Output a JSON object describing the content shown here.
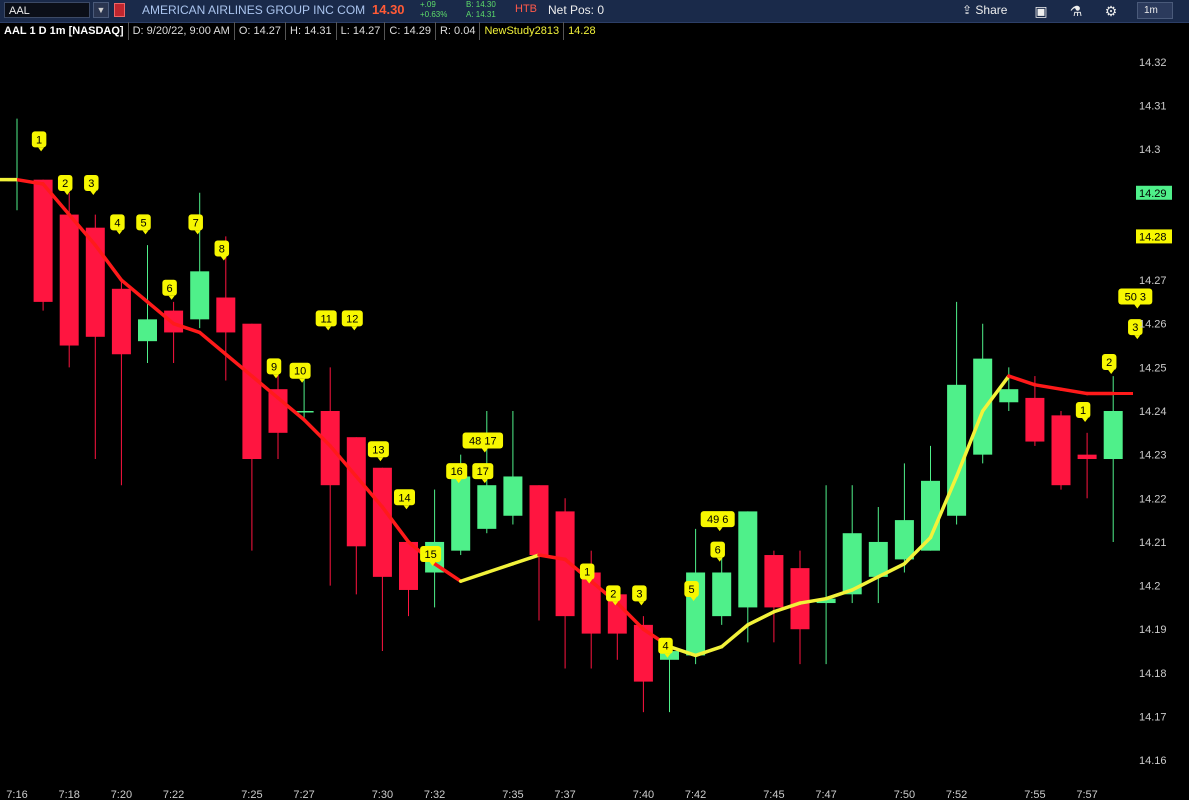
{
  "toolbar": {
    "symbol": "AAL",
    "company": "AMERICAN AIRLINES GROUP INC COM",
    "last": "14.30",
    "change_abs": "+.09",
    "change_pct": "+0.63%",
    "bid": "B: 14.30",
    "ask": "A: 14.31",
    "htb": "HTB",
    "net_pos": "Net Pos: 0",
    "share_label": "Share",
    "aggregation": "1m",
    "icons": [
      "dropdown-icon",
      "flag-icon",
      "share-icon",
      "details-icon",
      "flask-icon",
      "gear-icon"
    ]
  },
  "header": {
    "title": "AAL 1 D 1m [NASDAQ]",
    "date": "D: 9/20/22, 9:00 AM",
    "open": "O: 14.27",
    "high": "H: 14.31",
    "low": "L: 14.27",
    "close": "C: 14.29",
    "range": "R: 0.04",
    "study_name": "NewStudy2813",
    "study_value": "14.28"
  },
  "colors": {
    "up": "#4ff08a",
    "down": "#ff1540",
    "ma_up": "#f2f23a",
    "ma_down": "#ff1a1a",
    "marker": "#f7f700",
    "price_tag": "#4ff08a",
    "study_tag": "#f7f700"
  },
  "chart_data": {
    "type": "candlestick",
    "ylim": [
      14.155,
      14.325
    ],
    "y_ticks": [
      "14.32",
      "14.31",
      "14.3",
      "14.29",
      "14.28",
      "14.27",
      "14.26",
      "14.25",
      "14.24",
      "14.23",
      "14.22",
      "14.21",
      "14.2",
      "14.19",
      "14.18",
      "14.17",
      "14.16"
    ],
    "x_tick_labels": [
      {
        "i": 0,
        "label": "7:16"
      },
      {
        "i": 2,
        "label": "7:18"
      },
      {
        "i": 4,
        "label": "7:20"
      },
      {
        "i": 6,
        "label": "7:22"
      },
      {
        "i": 9,
        "label": "7:25"
      },
      {
        "i": 11,
        "label": "7:27"
      },
      {
        "i": 14,
        "label": "7:30"
      },
      {
        "i": 16,
        "label": "7:32"
      },
      {
        "i": 19,
        "label": "7:35"
      },
      {
        "i": 21,
        "label": "7:37"
      },
      {
        "i": 24,
        "label": "7:40"
      },
      {
        "i": 26,
        "label": "7:42"
      },
      {
        "i": 29,
        "label": "7:45"
      },
      {
        "i": 31,
        "label": "7:47"
      },
      {
        "i": 34,
        "label": "7:50"
      },
      {
        "i": 36,
        "label": "7:52"
      },
      {
        "i": 39,
        "label": "7:55"
      },
      {
        "i": 41,
        "label": "7:57"
      }
    ],
    "candles": [
      {
        "o": 14.293,
        "h": 14.307,
        "l": 14.286,
        "c": 14.293
      },
      {
        "o": 14.293,
        "h": 14.293,
        "l": 14.263,
        "c": 14.265
      },
      {
        "o": 14.285,
        "h": 14.29,
        "l": 14.25,
        "c": 14.255
      },
      {
        "o": 14.282,
        "h": 14.285,
        "l": 14.229,
        "c": 14.257
      },
      {
        "o": 14.268,
        "h": 14.27,
        "l": 14.223,
        "c": 14.253
      },
      {
        "o": 14.256,
        "h": 14.278,
        "l": 14.251,
        "c": 14.261
      },
      {
        "o": 14.263,
        "h": 14.265,
        "l": 14.251,
        "c": 14.258
      },
      {
        "o": 14.261,
        "h": 14.29,
        "l": 14.259,
        "c": 14.272
      },
      {
        "o": 14.266,
        "h": 14.28,
        "l": 14.247,
        "c": 14.258
      },
      {
        "o": 14.26,
        "h": 14.26,
        "l": 14.208,
        "c": 14.229
      },
      {
        "o": 14.245,
        "h": 14.25,
        "l": 14.229,
        "c": 14.235
      },
      {
        "o": 14.24,
        "h": 14.248,
        "l": 14.238,
        "c": 14.24
      },
      {
        "o": 14.24,
        "h": 14.25,
        "l": 14.2,
        "c": 14.223
      },
      {
        "o": 14.234,
        "h": 14.234,
        "l": 14.198,
        "c": 14.209
      },
      {
        "o": 14.227,
        "h": 14.227,
        "l": 14.185,
        "c": 14.202
      },
      {
        "o": 14.21,
        "h": 14.21,
        "l": 14.193,
        "c": 14.199
      },
      {
        "o": 14.203,
        "h": 14.222,
        "l": 14.195,
        "c": 14.21
      },
      {
        "o": 14.208,
        "h": 14.23,
        "l": 14.207,
        "c": 14.225
      },
      {
        "o": 14.213,
        "h": 14.24,
        "l": 14.212,
        "c": 14.223
      },
      {
        "o": 14.216,
        "h": 14.24,
        "l": 14.214,
        "c": 14.225
      },
      {
        "o": 14.223,
        "h": 14.223,
        "l": 14.192,
        "c": 14.207
      },
      {
        "o": 14.217,
        "h": 14.22,
        "l": 14.181,
        "c": 14.193
      },
      {
        "o": 14.203,
        "h": 14.208,
        "l": 14.181,
        "c": 14.189
      },
      {
        "o": 14.198,
        "h": 14.2,
        "l": 14.183,
        "c": 14.189
      },
      {
        "o": 14.191,
        "h": 14.193,
        "l": 14.171,
        "c": 14.178
      },
      {
        "o": 14.183,
        "h": 14.188,
        "l": 14.171,
        "c": 14.185
      },
      {
        "o": 14.184,
        "h": 14.213,
        "l": 14.182,
        "c": 14.203
      },
      {
        "o": 14.193,
        "h": 14.21,
        "l": 14.191,
        "c": 14.203
      },
      {
        "o": 14.195,
        "h": 14.217,
        "l": 14.187,
        "c": 14.217
      },
      {
        "o": 14.207,
        "h": 14.208,
        "l": 14.187,
        "c": 14.195
      },
      {
        "o": 14.204,
        "h": 14.208,
        "l": 14.182,
        "c": 14.19
      },
      {
        "o": 14.196,
        "h": 14.223,
        "l": 14.182,
        "c": 14.197
      },
      {
        "o": 14.198,
        "h": 14.223,
        "l": 14.196,
        "c": 14.212
      },
      {
        "o": 14.202,
        "h": 14.218,
        "l": 14.196,
        "c": 14.21
      },
      {
        "o": 14.206,
        "h": 14.228,
        "l": 14.203,
        "c": 14.215
      },
      {
        "o": 14.208,
        "h": 14.232,
        "l": 14.208,
        "c": 14.224
      },
      {
        "o": 14.216,
        "h": 14.265,
        "l": 14.214,
        "c": 14.246
      },
      {
        "o": 14.23,
        "h": 14.26,
        "l": 14.228,
        "c": 14.252
      },
      {
        "o": 14.242,
        "h": 14.25,
        "l": 14.24,
        "c": 14.245
      },
      {
        "o": 14.243,
        "h": 14.248,
        "l": 14.232,
        "c": 14.233
      },
      {
        "o": 14.239,
        "h": 14.24,
        "l": 14.222,
        "c": 14.223
      },
      {
        "o": 14.23,
        "h": 14.235,
        "l": 14.22,
        "c": 14.229
      },
      {
        "o": 14.229,
        "h": 14.248,
        "l": 14.21,
        "c": 14.24
      }
    ],
    "moving_average": [
      {
        "i": 0,
        "v": 14.293,
        "state": "up"
      },
      {
        "i": 1,
        "v": 14.292,
        "state": "down"
      },
      {
        "i": 2,
        "v": 14.285,
        "state": "down"
      },
      {
        "i": 3,
        "v": 14.278,
        "state": "down"
      },
      {
        "i": 4,
        "v": 14.27,
        "state": "down"
      },
      {
        "i": 5,
        "v": 14.265,
        "state": "down"
      },
      {
        "i": 6,
        "v": 14.26,
        "state": "down"
      },
      {
        "i": 7,
        "v": 14.258,
        "state": "down"
      },
      {
        "i": 8,
        "v": 14.253,
        "state": "down"
      },
      {
        "i": 9,
        "v": 14.248,
        "state": "down"
      },
      {
        "i": 10,
        "v": 14.243,
        "state": "down"
      },
      {
        "i": 11,
        "v": 14.238,
        "state": "down"
      },
      {
        "i": 12,
        "v": 14.232,
        "state": "down"
      },
      {
        "i": 13,
        "v": 14.225,
        "state": "down"
      },
      {
        "i": 14,
        "v": 14.218,
        "state": "down"
      },
      {
        "i": 15,
        "v": 14.21,
        "state": "down"
      },
      {
        "i": 16,
        "v": 14.205,
        "state": "down"
      },
      {
        "i": 17,
        "v": 14.201,
        "state": "down"
      },
      {
        "i": 18,
        "v": 14.203,
        "state": "up"
      },
      {
        "i": 19,
        "v": 14.205,
        "state": "up"
      },
      {
        "i": 20,
        "v": 14.207,
        "state": "up"
      },
      {
        "i": 21,
        "v": 14.206,
        "state": "down"
      },
      {
        "i": 22,
        "v": 14.201,
        "state": "down"
      },
      {
        "i": 23,
        "v": 14.196,
        "state": "down"
      },
      {
        "i": 24,
        "v": 14.19,
        "state": "down"
      },
      {
        "i": 25,
        "v": 14.186,
        "state": "down"
      },
      {
        "i": 26,
        "v": 14.184,
        "state": "up"
      },
      {
        "i": 27,
        "v": 14.186,
        "state": "up"
      },
      {
        "i": 28,
        "v": 14.191,
        "state": "up"
      },
      {
        "i": 29,
        "v": 14.194,
        "state": "up"
      },
      {
        "i": 30,
        "v": 14.196,
        "state": "up"
      },
      {
        "i": 31,
        "v": 14.197,
        "state": "up"
      },
      {
        "i": 32,
        "v": 14.199,
        "state": "up"
      },
      {
        "i": 33,
        "v": 14.202,
        "state": "up"
      },
      {
        "i": 34,
        "v": 14.205,
        "state": "up"
      },
      {
        "i": 35,
        "v": 14.211,
        "state": "up"
      },
      {
        "i": 36,
        "v": 14.225,
        "state": "up"
      },
      {
        "i": 37,
        "v": 14.24,
        "state": "up"
      },
      {
        "i": 38,
        "v": 14.248,
        "state": "up"
      },
      {
        "i": 39,
        "v": 14.246,
        "state": "down"
      },
      {
        "i": 40,
        "v": 14.245,
        "state": "down"
      },
      {
        "i": 41,
        "v": 14.244,
        "state": "down"
      },
      {
        "i": 42,
        "v": 14.244,
        "state": "down"
      }
    ],
    "markers": [
      {
        "i": 1,
        "label": "1",
        "y": 14.302
      },
      {
        "i": 2,
        "label": "2",
        "y": 14.292
      },
      {
        "i": 3,
        "label": "3",
        "y": 14.292
      },
      {
        "i": 4,
        "label": "4",
        "y": 14.283
      },
      {
        "i": 5,
        "label": "5",
        "y": 14.283
      },
      {
        "i": 6,
        "label": "6",
        "y": 14.268
      },
      {
        "i": 7,
        "label": "7",
        "y": 14.283
      },
      {
        "i": 8,
        "label": "8",
        "y": 14.277
      },
      {
        "i": 10,
        "label": "9",
        "y": 14.25
      },
      {
        "i": 11,
        "label": "10",
        "y": 14.249
      },
      {
        "i": 12,
        "label": "11",
        "y": 14.261
      },
      {
        "i": 13,
        "label": "12",
        "y": 14.261
      },
      {
        "i": 14,
        "label": "13",
        "y": 14.231
      },
      {
        "i": 15,
        "label": "14",
        "y": 14.22
      },
      {
        "i": 16,
        "label": "15",
        "y": 14.207
      },
      {
        "i": 17,
        "label": "16",
        "y": 14.226
      },
      {
        "i": 18,
        "label": "17",
        "y": 14.226
      },
      {
        "i": 18,
        "label": "48 17",
        "y": 14.233
      },
      {
        "i": 22,
        "label": "1",
        "y": 14.203
      },
      {
        "i": 23,
        "label": "2",
        "y": 14.198
      },
      {
        "i": 24,
        "label": "3",
        "y": 14.198
      },
      {
        "i": 25,
        "label": "4",
        "y": 14.186
      },
      {
        "i": 26,
        "label": "5",
        "y": 14.199
      },
      {
        "i": 27,
        "label": "6",
        "y": 14.208
      },
      {
        "i": 27,
        "label": "49 6",
        "y": 14.215
      },
      {
        "i": 41,
        "label": "1",
        "y": 14.24
      },
      {
        "i": 42,
        "label": "2",
        "y": 14.251
      },
      {
        "i": 43,
        "label": "3",
        "y": 14.259
      },
      {
        "i": 43,
        "label": "50 3",
        "y": 14.266
      }
    ],
    "last_price_tag": "14.29",
    "study_tag": "14.28",
    "last_price_value": 14.29,
    "study_value": 14.28
  }
}
